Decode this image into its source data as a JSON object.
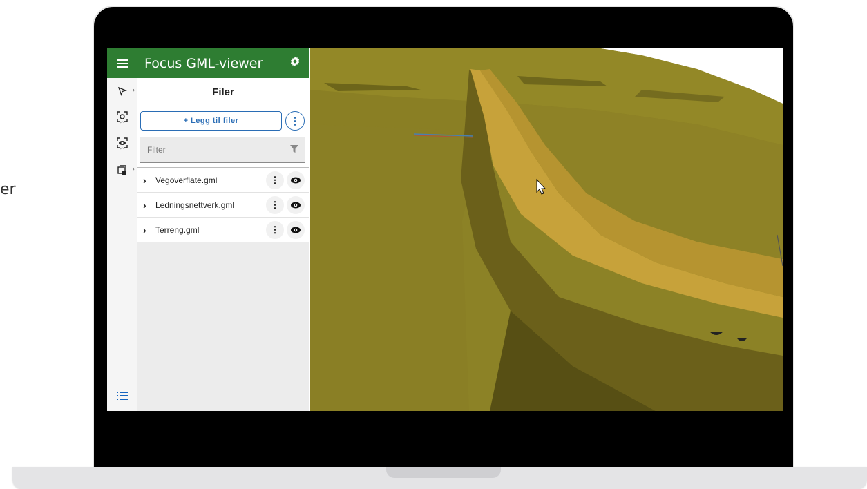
{
  "side_text": "er",
  "app": {
    "title": "Focus GML-viewer"
  },
  "panel": {
    "section_title": "Filer",
    "add_files_label": "+ Legg til filer",
    "filter_placeholder": "Filter"
  },
  "files": [
    {
      "name": "Vegoverflate.gml"
    },
    {
      "name": "Ledningsnettverk.gml"
    },
    {
      "name": "Terreng.gml"
    }
  ],
  "icons": {
    "menu": "hamburger-icon",
    "settings": "gear-icon",
    "select": "cursor-select-icon",
    "zoom_to": "focus-icon",
    "visibility": "eye-icon",
    "layers": "box-layers-icon",
    "list": "list-icon",
    "filter": "funnel-icon",
    "more": "more-vertical-icon",
    "expand": "chevron-right-icon"
  },
  "colors": {
    "header_green": "#2e7d32",
    "accent_blue": "#2a6db5",
    "terrain": "#8f8426",
    "road": "#c9a53b"
  }
}
